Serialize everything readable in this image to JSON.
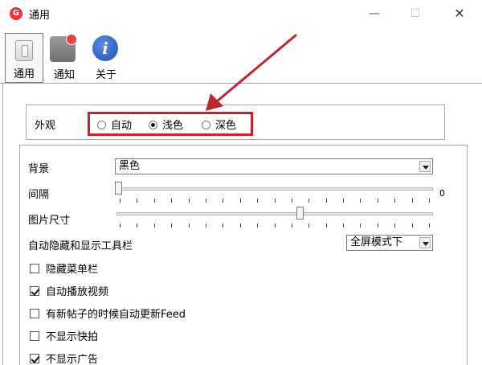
{
  "window": {
    "title": "通用",
    "logo_letter": "G"
  },
  "toolbar": {
    "items": [
      {
        "label": "通用"
      },
      {
        "label": "通知"
      },
      {
        "label": "关于"
      }
    ],
    "about_glyph": "i"
  },
  "appearance": {
    "label": "外观",
    "options": [
      {
        "label": "自动",
        "selected": false
      },
      {
        "label": "浅色",
        "selected": true
      },
      {
        "label": "深色",
        "selected": false
      }
    ]
  },
  "settings": {
    "background": {
      "label": "背景",
      "value": "黑色"
    },
    "spacing": {
      "label": "间隔",
      "value": "0",
      "level": 0
    },
    "image_size": {
      "label": "图片尺寸",
      "level": 0.58
    },
    "autohide": {
      "label": "自动隐藏和显示工具栏",
      "value": "全屏模式下"
    },
    "checkboxes": [
      {
        "label": "隐藏菜单栏",
        "checked": false
      },
      {
        "label": "自动播放视频",
        "checked": true
      },
      {
        "label": "有新帖子的时候自动更新Feed",
        "checked": false
      },
      {
        "label": "不显示快拍",
        "checked": false
      },
      {
        "label": "不显示广告",
        "checked": true
      }
    ]
  },
  "colors": {
    "highlight": "#d0202c",
    "arrow": "#c0262f"
  }
}
